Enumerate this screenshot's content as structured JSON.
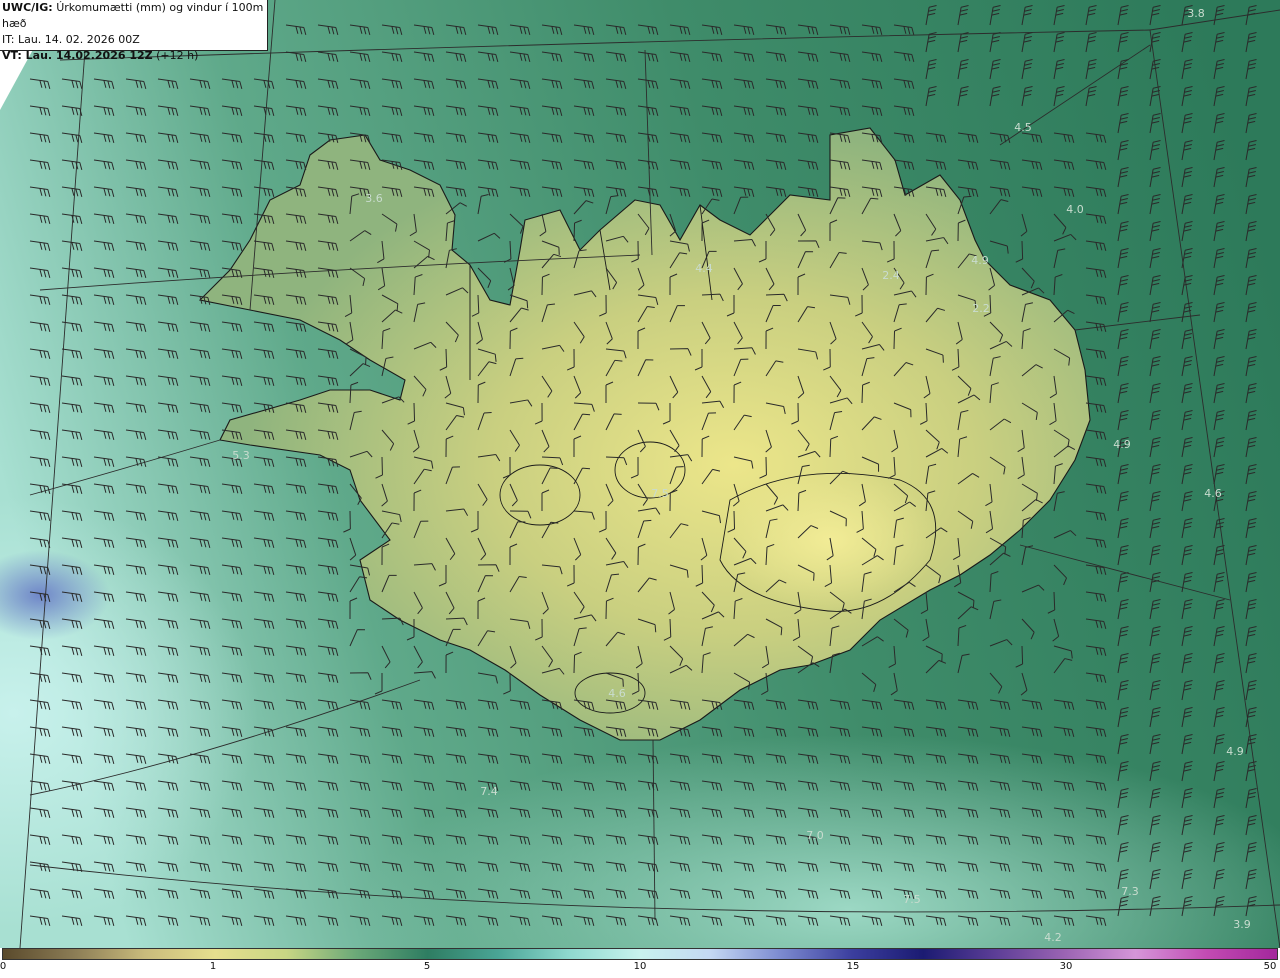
{
  "header": {
    "title_prefix": "UWC/IG:",
    "title_text": "Úrkomumætti (mm) og vindur í 100m hæð",
    "it_line": "IT: Lau. 14. 02. 2026 00Z",
    "vt_prefix": "VT: Lau. 14.02.2026 12Z",
    "vt_suffix": "(+12 h)"
  },
  "map": {
    "colors": {
      "ocean_dark": "#2f7a5c",
      "ocean_mid": "#5fa889",
      "ocean_light": "#bdeae2",
      "land_low": "#9ab57c",
      "land_high": "#e9e48a",
      "coast": "#1a1a1a",
      "grid": "#333333",
      "barb": "#2a2a2a",
      "label": "#c9dccf"
    },
    "value_labels": [
      "3.8",
      "4.5",
      "4.0",
      "3.6",
      "4.4",
      "2.4",
      "4.9",
      "2.2",
      "4.9",
      "4.6",
      "5.3",
      "7.5",
      "4.6",
      "4.9",
      "7.4",
      "7.0",
      "7.3",
      "7.5",
      "4.2",
      "3.9"
    ],
    "barb_icon": "wind-barb-icon"
  },
  "colorbar": {
    "ticks": [
      "0",
      "1",
      "5",
      "10",
      "15",
      "30",
      "50"
    ],
    "colors": [
      "#5a4a2c",
      "#8b7c55",
      "#c9bb7c",
      "#e6df8e",
      "#c8d684",
      "#6aa878",
      "#2e7d62",
      "#4aa596",
      "#8fd9cf",
      "#c8f2ee",
      "#c4d8f3",
      "#7b89cf",
      "#3b3e9e",
      "#1b1b72",
      "#5b3d96",
      "#9b64b3",
      "#d596d9",
      "#c24bb3",
      "#a3279c"
    ]
  }
}
